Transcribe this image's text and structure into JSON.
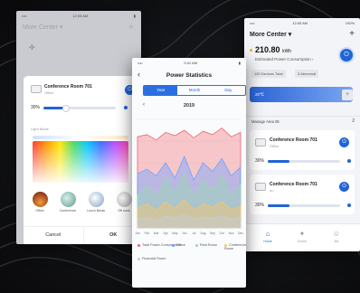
{
  "left_screen": {
    "status_time": "12:05 AM",
    "header_title": "More Center ▾",
    "card": {
      "room_name": "Conference Room 701",
      "room_sub": "Office",
      "brightness": "30%",
      "brightness_level": 0.3,
      "light_mode_label": "Light Mode",
      "scenes": [
        {
          "label": "Office",
          "color": "#c5471e"
        },
        {
          "label": "Conference",
          "color": "#7fb3a8"
        },
        {
          "label": "Lunch Break",
          "color": "#9bb9d6"
        },
        {
          "label": "Off work",
          "color": "#c9c9c9"
        }
      ],
      "cancel_label": "Cancel",
      "ok_label": "OK"
    }
  },
  "middle_screen": {
    "status_time": "9:41 AM",
    "title": "Power Statistics",
    "tabs": [
      {
        "label": "Year",
        "active": true
      },
      {
        "label": "Month",
        "active": false
      },
      {
        "label": "Day",
        "active": false
      }
    ],
    "year": "2019",
    "chart_data": {
      "type": "area",
      "categories": [
        "Jan",
        "Feb",
        "Mar",
        "Apr",
        "May",
        "Jun",
        "Jul",
        "Aug",
        "Sep",
        "Oct",
        "Nov",
        "Dec"
      ],
      "series": [
        {
          "name": "Total Power Consumption",
          "color": "#f0636b",
          "values": [
            420,
            430,
            405,
            440,
            425,
            450,
            415,
            445,
            430,
            460,
            420,
            440
          ]
        },
        {
          "name": "Office",
          "color": "#6ea3ff",
          "values": [
            250,
            270,
            240,
            300,
            230,
            330,
            220,
            300,
            260,
            320,
            240,
            280
          ]
        },
        {
          "name": "Rest Room",
          "color": "#9ad7b3",
          "values": [
            150,
            200,
            140,
            230,
            160,
            250,
            140,
            220,
            170,
            240,
            150,
            200
          ]
        },
        {
          "name": "Conference Room",
          "color": "#f7c56b",
          "values": [
            90,
            110,
            80,
            120,
            90,
            130,
            80,
            110,
            95,
            120,
            85,
            100
          ]
        },
        {
          "name": "Financial Room",
          "color": "#c9cbd2",
          "values": [
            40,
            50,
            35,
            55,
            45,
            60,
            40,
            50,
            45,
            55,
            40,
            50
          ]
        }
      ],
      "y_ticks": [
        "0",
        "100",
        "200",
        "300",
        "400",
        "500"
      ]
    }
  },
  "right_screen": {
    "status_time": "12:05 AM",
    "battery": "100%",
    "header_title": "More Center ▾",
    "power_value": "210.",
    "power_decimals": "80",
    "power_unit": "kWh",
    "estimated_label": "Estimated Power Consumption ›",
    "tags": [
      "120 Devices Total",
      "3 Abnormal"
    ],
    "band_label": "20℃",
    "area_label": "Manage Area 05",
    "area_count": "2",
    "rooms": [
      {
        "name": "Conference Room 701",
        "sub": "Office",
        "brightness": "30%",
        "level": 0.3
      },
      {
        "name": "Conference Room 701",
        "sub": "on",
        "brightness": "30%",
        "level": 0.3
      }
    ],
    "tabs": [
      {
        "label": "Home",
        "glyph": "⌂",
        "active": true
      },
      {
        "label": "Scene",
        "glyph": "✦",
        "active": false
      },
      {
        "label": "Me",
        "glyph": "☺",
        "active": false
      }
    ]
  }
}
